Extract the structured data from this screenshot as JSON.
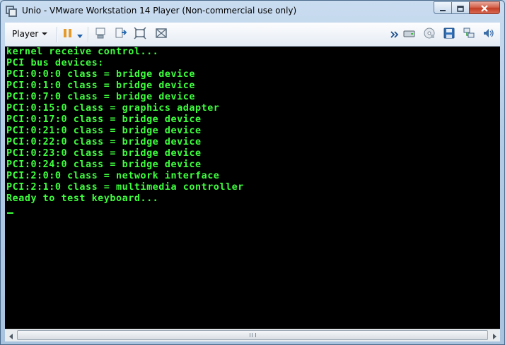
{
  "window": {
    "title": "Unio - VMware Workstation 14 Player (Non-commercial use only)"
  },
  "toolbar": {
    "player_menu_label": "Player",
    "left_icons": [
      "pause-icon",
      "dropdown-arrow-icon",
      "send-ctrl-alt-del-icon",
      "unity-icon",
      "fit-guest-icon",
      "full-screen-icon"
    ],
    "right_icons": [
      "more-chevron-icon",
      "hard-disk-icon",
      "cd-dvd-icon",
      "floppy-icon",
      "network-adapter-icon",
      "sound-card-icon"
    ]
  },
  "console": {
    "lines": [
      "kernel receive control...",
      "PCI bus devices:",
      "PCI:0:0:0 class = bridge device",
      "PCI:0:1:0 class = bridge device",
      "PCI:0:7:0 class = bridge device",
      "PCI:0:15:0 class = graphics adapter",
      "PCI:0:17:0 class = bridge device",
      "PCI:0:21:0 class = bridge device",
      "PCI:0:22:0 class = bridge device",
      "PCI:0:23:0 class = bridge device",
      "PCI:0:24:0 class = bridge device",
      "PCI:2:0:0 class = network interface",
      "PCI:2:1:0 class = multimedia controller",
      "Ready to test keyboard..."
    ],
    "text_color": "#3dff3d",
    "background": "#000000"
  }
}
